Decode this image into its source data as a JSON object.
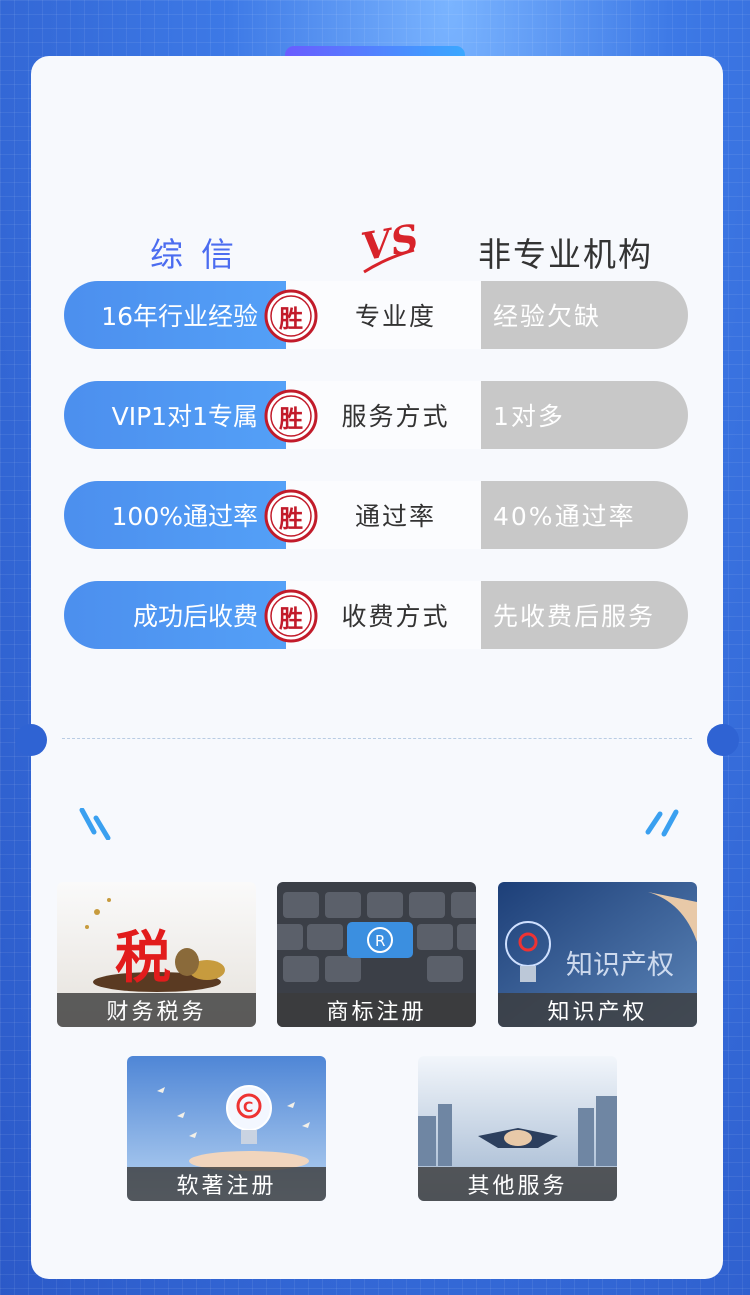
{
  "header": {
    "left_title": "综信",
    "vs_label": "VS",
    "right_title": "非专业机构"
  },
  "comparisons": [
    {
      "ours": "16年行业经验",
      "seal": "胜",
      "criterion": "专业度",
      "theirs": "经验欠缺"
    },
    {
      "ours": "VIP1对1专属",
      "seal": "胜",
      "criterion": "服务方式",
      "theirs": "1对多"
    },
    {
      "ours": "100%通过率",
      "seal": "胜",
      "criterion": "通过率",
      "theirs": "40%通过率"
    },
    {
      "ours": "成功后收费",
      "seal": "胜",
      "criterion": "收费方式",
      "theirs": "先收费后服务"
    }
  ],
  "services": [
    {
      "label": "财务税务",
      "icon": "tax-icon"
    },
    {
      "label": "商标注册",
      "icon": "trademark-icon"
    },
    {
      "label": "知识产权",
      "icon": "ip-bulb-icon"
    },
    {
      "label": "软著注册",
      "icon": "copyright-bulb-icon"
    },
    {
      "label": "其他服务",
      "icon": "handshake-icon"
    }
  ],
  "tile_texts": {
    "tax_char": "税",
    "trademark_symbol": "R",
    "ip_text": "知识产权",
    "copyright_symbol": "C"
  },
  "colors": {
    "accent_blue": "#4c8fee",
    "seal_red": "#c21b2a",
    "grey_pill": "#c8c8c8"
  }
}
